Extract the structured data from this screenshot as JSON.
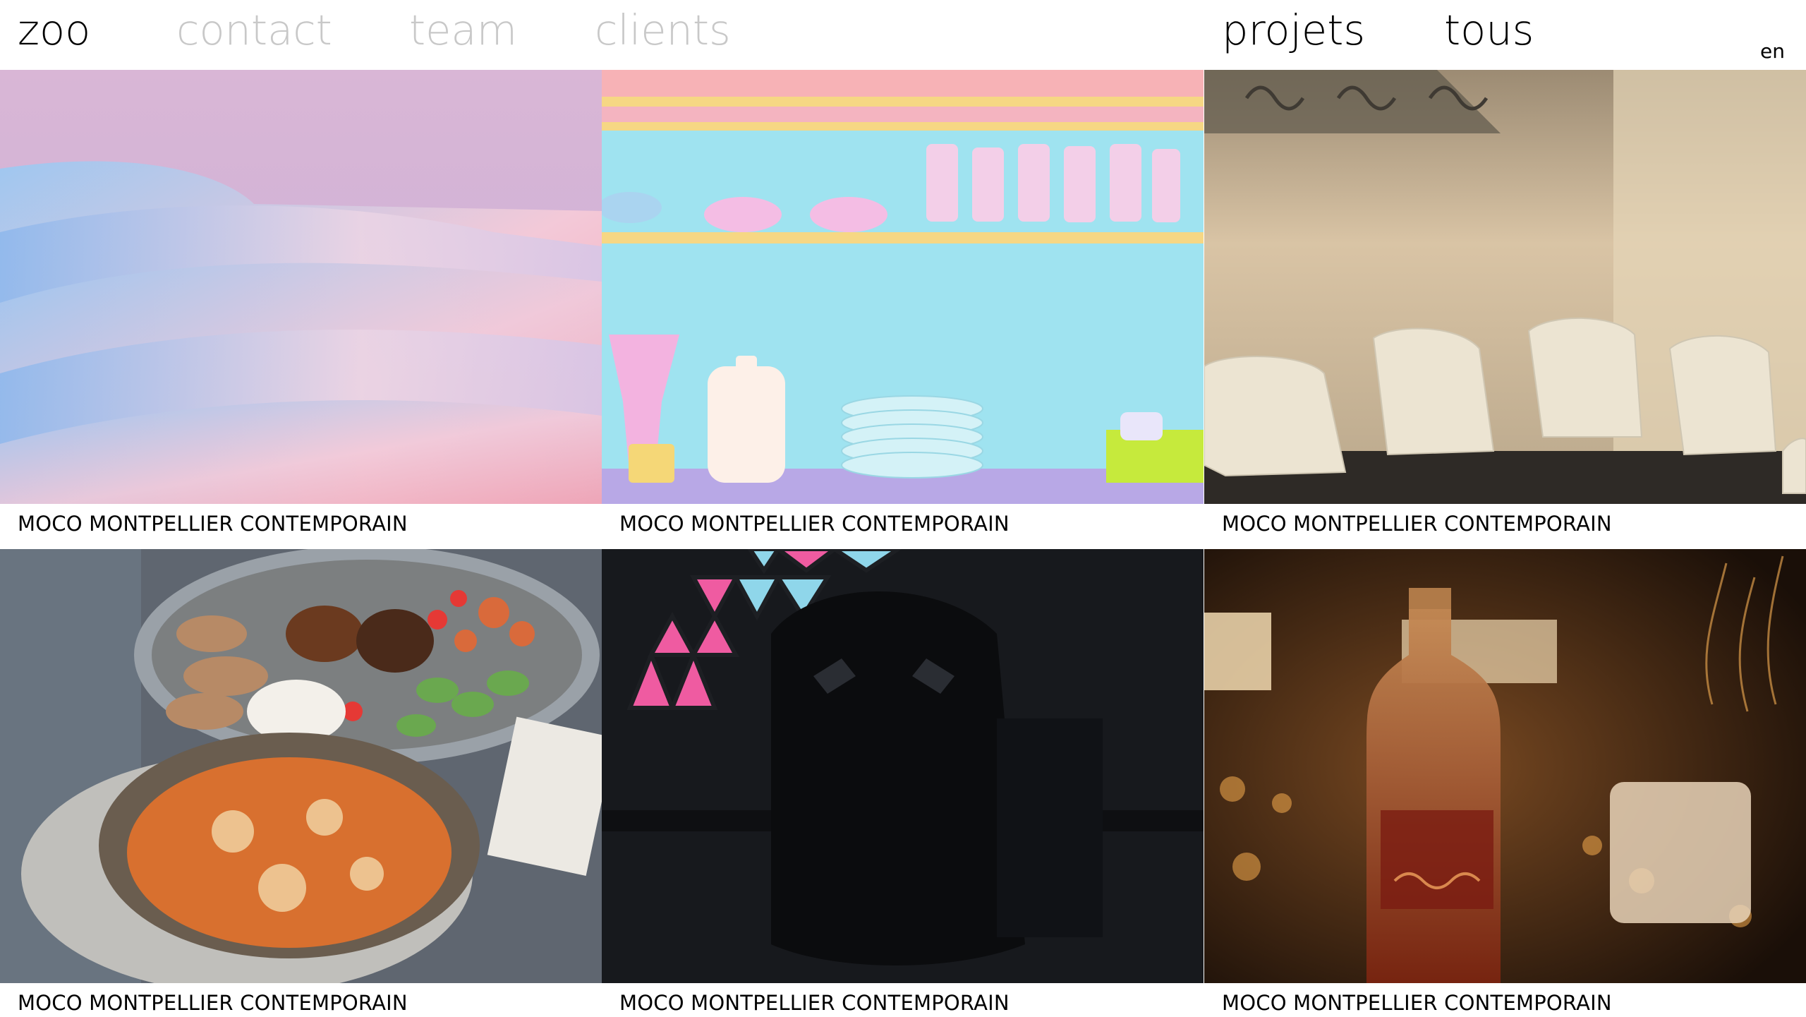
{
  "header": {
    "brand": "zoo",
    "nav": [
      {
        "label": "contact",
        "state": "muted"
      },
      {
        "label": "team",
        "state": "muted"
      },
      {
        "label": "clients",
        "state": "muted"
      }
    ],
    "section_nav": [
      {
        "label": "projets",
        "state": "active"
      },
      {
        "label": "tous",
        "state": "active"
      }
    ],
    "language": "en"
  },
  "colors": {
    "active_text": "#000000",
    "muted_text": "#c8c8c8",
    "background": "#ffffff"
  },
  "projects": [
    {
      "caption": "MOCO MONTPELLIER CONTEMPORAIN",
      "image": "pastel-abstract-waves"
    },
    {
      "caption": "MOCO MONTPELLIER CONTEMPORAIN",
      "image": "pastel-kitchen-shelves"
    },
    {
      "caption": "MOCO MONTPELLIER CONTEMPORAIN",
      "image": "white-chairs-room"
    },
    {
      "caption": "MOCO MONTPELLIER CONTEMPORAIN",
      "image": "food-platter-shakshuka"
    },
    {
      "caption": "MOCO MONTPELLIER CONTEMPORAIN",
      "image": "gaming-chair-light-panels"
    },
    {
      "caption": "MOCO MONTPELLIER CONTEMPORAIN",
      "image": "rum-bottle-bar"
    }
  ]
}
